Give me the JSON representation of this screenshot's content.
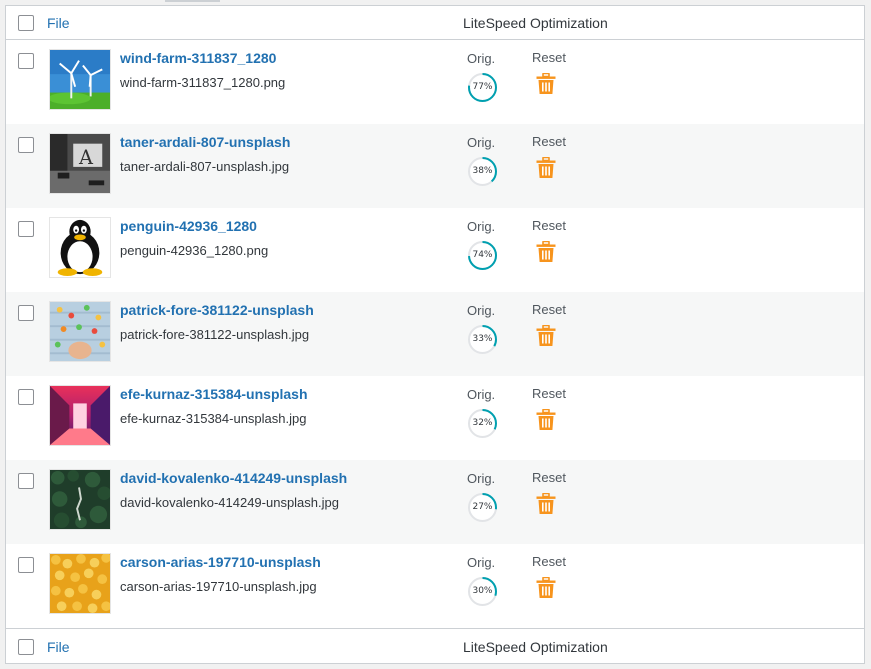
{
  "header": {
    "col_file": "File",
    "col_optimization": "LiteSpeed Optimization"
  },
  "footer": {
    "col_file": "File",
    "col_optimization": "LiteSpeed Optimization"
  },
  "rows": [
    {
      "title": "wind-farm-311837_1280",
      "filename": "wind-farm-311837_1280.png",
      "orig_label": "Orig.",
      "reset_label": "Reset",
      "percent": 77,
      "percent_label": "77%",
      "thumb": "wind-farm-image"
    },
    {
      "title": "taner-ardali-807-unsplash",
      "filename": "taner-ardali-807-unsplash.jpg",
      "orig_label": "Orig.",
      "reset_label": "Reset",
      "percent": 38,
      "percent_label": "38%",
      "thumb": "desk-image"
    },
    {
      "title": "penguin-42936_1280",
      "filename": "penguin-42936_1280.png",
      "orig_label": "Orig.",
      "reset_label": "Reset",
      "percent": 74,
      "percent_label": "74%",
      "thumb": "penguin-image"
    },
    {
      "title": "patrick-fore-381122-unsplash",
      "filename": "patrick-fore-381122-unsplash.jpg",
      "orig_label": "Orig.",
      "reset_label": "Reset",
      "percent": 33,
      "percent_label": "33%",
      "thumb": "candy-image"
    },
    {
      "title": "efe-kurnaz-315384-unsplash",
      "filename": "efe-kurnaz-315384-unsplash.jpg",
      "orig_label": "Orig.",
      "reset_label": "Reset",
      "percent": 32,
      "percent_label": "32%",
      "thumb": "neon-corridor-image"
    },
    {
      "title": "david-kovalenko-414249-unsplash",
      "filename": "david-kovalenko-414249-unsplash.jpg",
      "orig_label": "Orig.",
      "reset_label": "Reset",
      "percent": 27,
      "percent_label": "27%",
      "thumb": "forest-image"
    },
    {
      "title": "carson-arias-197710-unsplash",
      "filename": "carson-arias-197710-unsplash.jpg",
      "orig_label": "Orig.",
      "reset_label": "Reset",
      "percent": 30,
      "percent_label": "30%",
      "thumb": "popcorn-image"
    }
  ],
  "colors": {
    "link": "#2271b1",
    "ring": "#00a0b0",
    "ring_track": "#e2e4e7",
    "trash": "#f7941d",
    "row_alt": "#f6f7f7",
    "border": "#ccd0d4"
  },
  "icons": {
    "delete": "trash-icon"
  }
}
